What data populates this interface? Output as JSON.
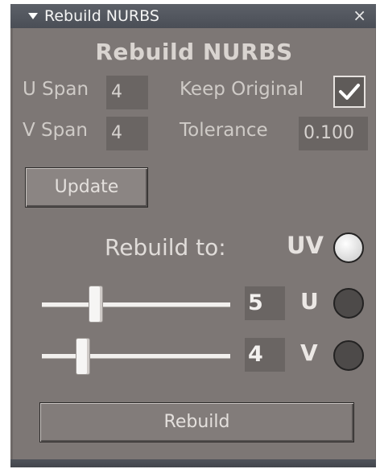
{
  "window": {
    "title": "Rebuild NURBS",
    "close_glyph": "×"
  },
  "panel": {
    "heading": "Rebuild NURBS",
    "u_span": {
      "label": "U Span",
      "value": "4"
    },
    "v_span": {
      "label": "V Span",
      "value": "4"
    },
    "keep_original": {
      "label": "Keep Original",
      "checked": true
    },
    "tolerance": {
      "label": "Tolerance",
      "value": "0.100"
    },
    "update_button": "Update",
    "rebuild_to": {
      "label": "Rebuild to:",
      "uv": {
        "label": "UV",
        "selected": true
      },
      "u": {
        "label": "U",
        "value": "5",
        "selected": false
      },
      "v": {
        "label": "V",
        "value": "4",
        "selected": false
      }
    },
    "rebuild_button": "Rebuild"
  },
  "colors": {
    "panel_bg": "#7d7775",
    "title_bg": "#50545c",
    "field_bg": "#6a6563",
    "text": "#cfcbc7"
  }
}
